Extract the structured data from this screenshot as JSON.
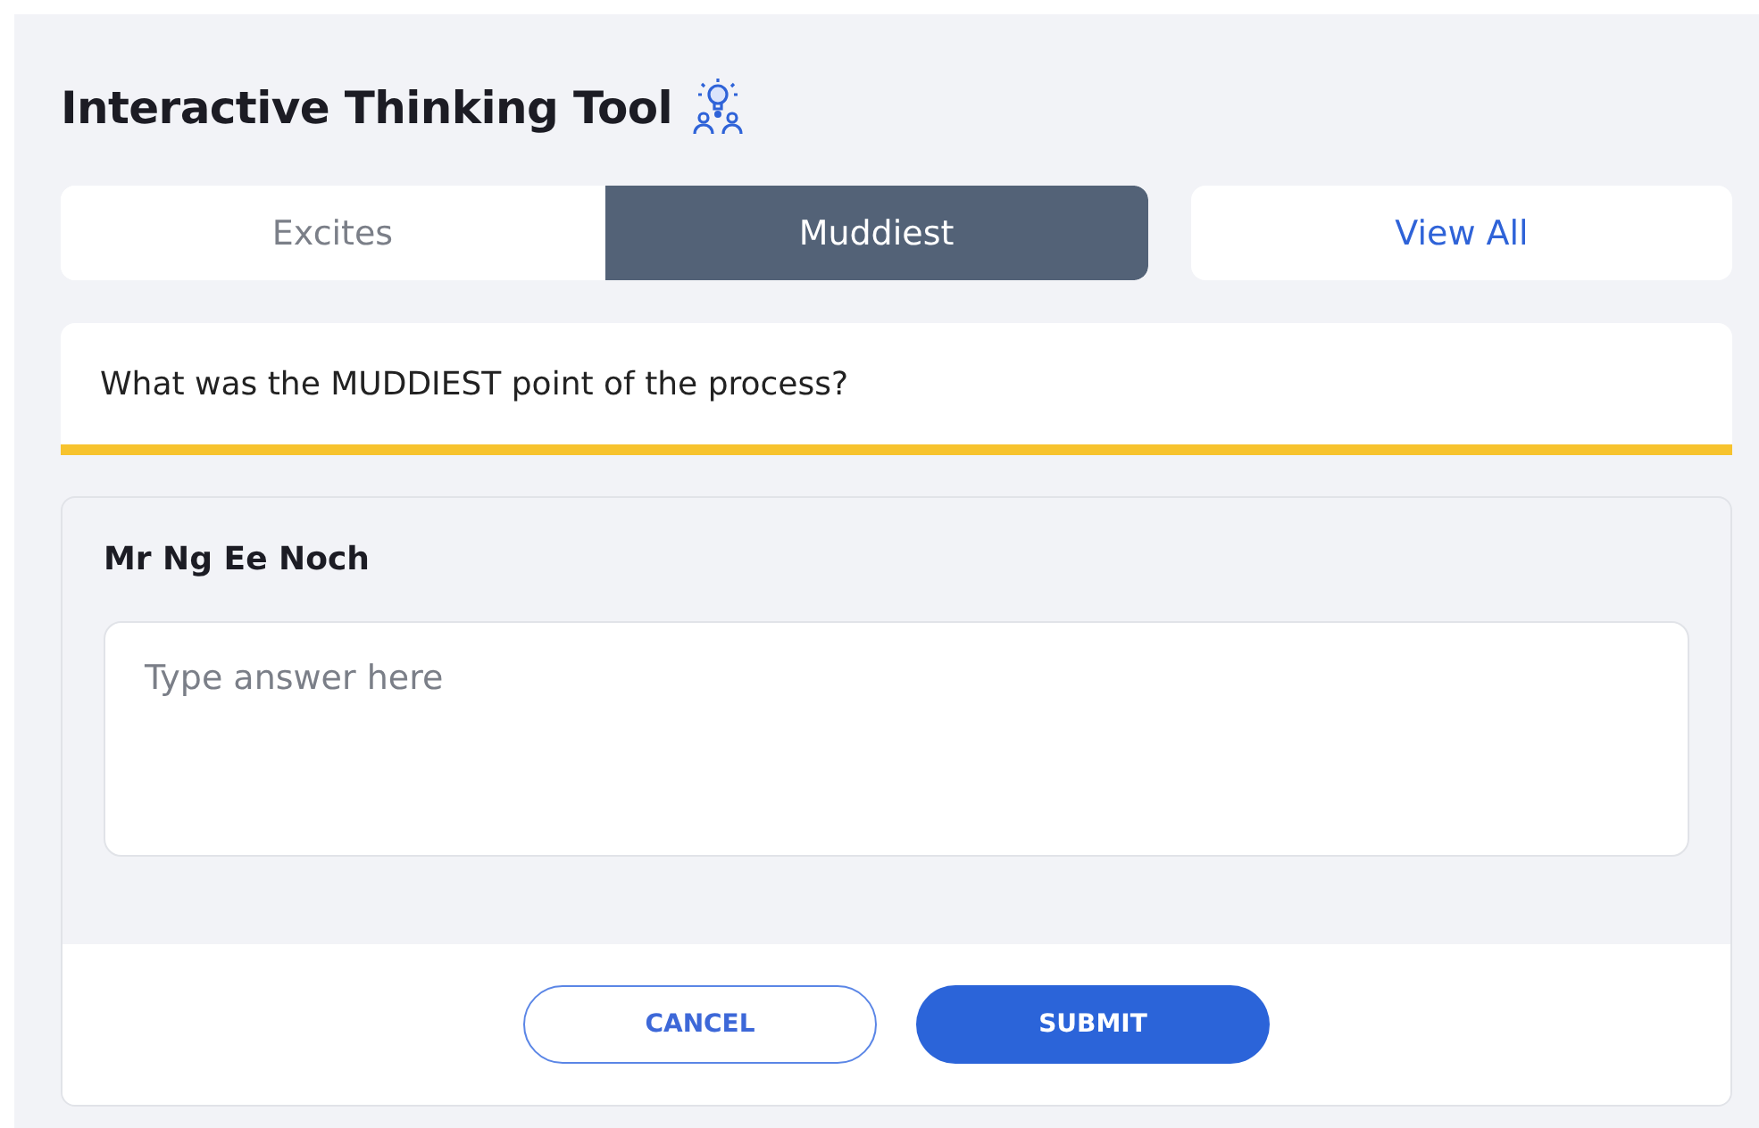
{
  "title": "Interactive Thinking Tool",
  "tabs": [
    {
      "label": "Excites",
      "selected": false
    },
    {
      "label": "Muddiest",
      "selected": true
    }
  ],
  "view_all": "View All",
  "question": "What was the MUDDIEST point of the process?",
  "answer": {
    "name": "Mr Ng Ee Noch",
    "placeholder": "Type answer here"
  },
  "buttons": [
    {
      "label": "CANCEL",
      "kind": "secondary"
    },
    {
      "label": "SUBMIT",
      "kind": "primary"
    }
  ]
}
